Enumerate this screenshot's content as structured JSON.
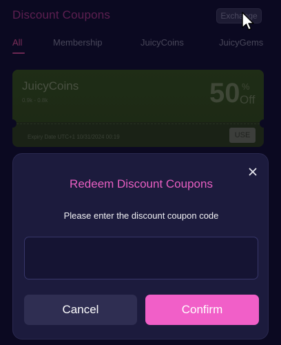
{
  "header": {
    "title": "Discount Coupons",
    "exchange_label": "Exchange"
  },
  "tabs": [
    {
      "label": "All",
      "active": true
    },
    {
      "label": "Membership",
      "active": false
    },
    {
      "label": "JuicyCoins",
      "active": false
    },
    {
      "label": "JuicyGems",
      "active": false
    }
  ],
  "coupon": {
    "name": "JuicyCoins",
    "subtitle": "0.9k - 0.8k",
    "discount_value": "50",
    "discount_percent": "%",
    "discount_off": "Off",
    "expiry": "Expiry Date UTC+1 10/31/2024 00:19",
    "use_label": "USE",
    "card_color": "#2d4419"
  },
  "modal": {
    "title": "Redeem Discount Coupons",
    "prompt": "Please enter the discount coupon code",
    "input_value": "",
    "cancel_label": "Cancel",
    "confirm_label": "Confirm",
    "accent_color": "#f15fc8",
    "close_icon": "close-icon"
  }
}
